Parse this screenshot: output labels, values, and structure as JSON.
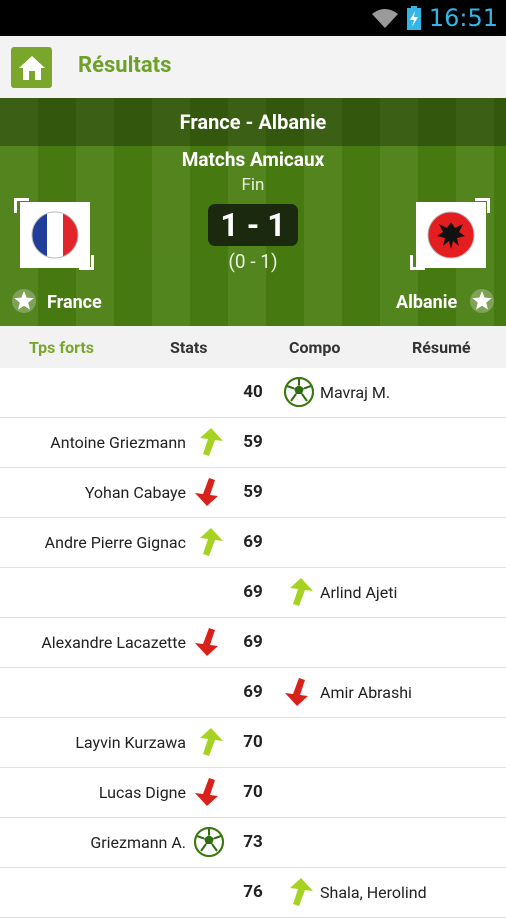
{
  "status_bar": {
    "time": "16:51",
    "icons": [
      "wifi-icon",
      "battery-icon"
    ]
  },
  "app_bar": {
    "title": "Résultats",
    "home_icon": "home-icon"
  },
  "match": {
    "title": "France - Albanie",
    "competition": "Matchs Amicaux",
    "status": "Fin",
    "score": "1 - 1",
    "halftime": "(0 - 1)",
    "home_team": "France",
    "away_team": "Albanie"
  },
  "tabs": [
    {
      "label": "Tps forts",
      "active": true
    },
    {
      "label": "Stats",
      "active": false
    },
    {
      "label": "Compo",
      "active": false
    },
    {
      "label": "Résumé",
      "active": false
    }
  ],
  "events": [
    {
      "minute": "40",
      "home_player": "",
      "away_player": "Mavraj M.",
      "type": "goal",
      "side": "away"
    },
    {
      "minute": "59",
      "home_player": "Antoine Griezmann",
      "away_player": "",
      "type": "sub-in",
      "side": "home"
    },
    {
      "minute": "59",
      "home_player": "Yohan Cabaye",
      "away_player": "",
      "type": "sub-out",
      "side": "home"
    },
    {
      "minute": "69",
      "home_player": "Andre Pierre Gignac",
      "away_player": "",
      "type": "sub-in",
      "side": "home"
    },
    {
      "minute": "69",
      "home_player": "",
      "away_player": "Arlind Ajeti",
      "type": "sub-in",
      "side": "away"
    },
    {
      "minute": "69",
      "home_player": "Alexandre Lacazette",
      "away_player": "",
      "type": "sub-out",
      "side": "home"
    },
    {
      "minute": "69",
      "home_player": "",
      "away_player": "Amir Abrashi",
      "type": "sub-out",
      "side": "away"
    },
    {
      "minute": "70",
      "home_player": "Layvin Kurzawa",
      "away_player": "",
      "type": "sub-in",
      "side": "home"
    },
    {
      "minute": "70",
      "home_player": "Lucas Digne",
      "away_player": "",
      "type": "sub-out",
      "side": "home"
    },
    {
      "minute": "73",
      "home_player": "Griezmann A.",
      "away_player": "",
      "type": "goal",
      "side": "home"
    },
    {
      "minute": "76",
      "home_player": "",
      "away_player": "Shala, Herolind",
      "type": "sub-in",
      "side": "away"
    }
  ],
  "colors": {
    "accent": "#79a62b",
    "header_green": "#4a7e12",
    "sub_in": "#a6d323",
    "sub_out": "#d9211c",
    "clock": "#33b5e5"
  }
}
